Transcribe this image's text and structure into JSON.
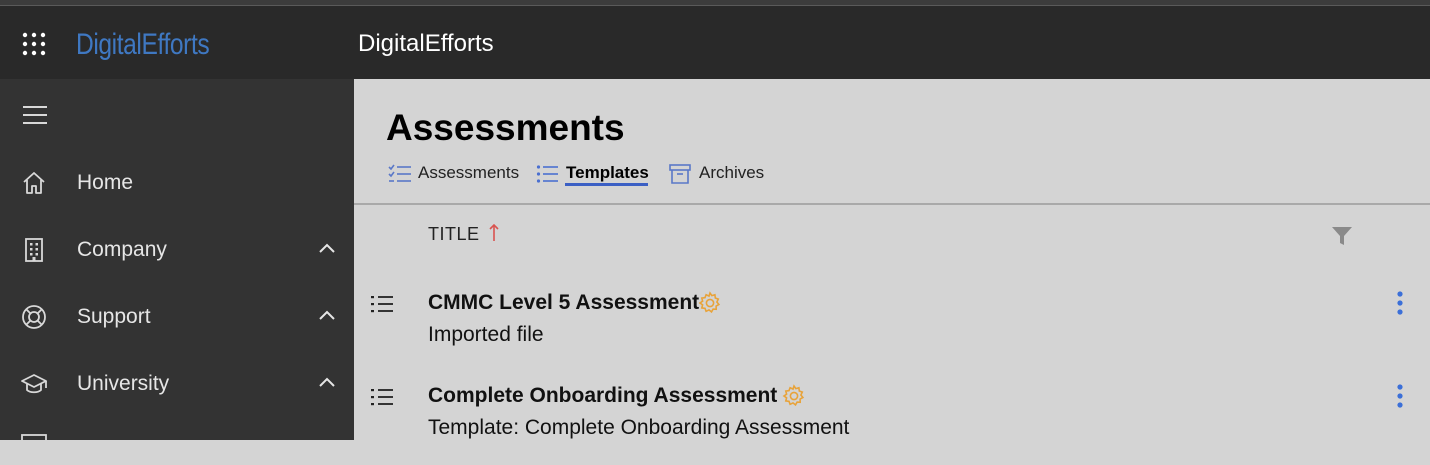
{
  "header": {
    "brand_logo": "DigitalEfforts",
    "app_title": "DigitalEfforts",
    "brand_color": "#3f78c2"
  },
  "sidebar": {
    "menu_icon": "hamburger-icon",
    "items": [
      {
        "label": "Home",
        "icon": "home-icon",
        "expandable": false
      },
      {
        "label": "Company",
        "icon": "building-icon",
        "expandable": true
      },
      {
        "label": "Support",
        "icon": "lifebuoy-icon",
        "expandable": true
      },
      {
        "label": "University",
        "icon": "graduation-cap-icon",
        "expandable": true
      }
    ]
  },
  "main": {
    "page_title": "Assessments",
    "tabs": [
      {
        "label": "Assessments",
        "icon": "checklist-icon",
        "active": false
      },
      {
        "label": "Templates",
        "icon": "list-icon",
        "active": true
      },
      {
        "label": "Archives",
        "icon": "archive-icon",
        "active": false
      }
    ],
    "table": {
      "column_header": "TITLE",
      "sort": "ascending",
      "rows": [
        {
          "title": "CMMC Level 5 Assessment",
          "subtitle": "Imported file"
        },
        {
          "title": "Complete Onboarding Assessment",
          "subtitle": "Template: Complete Onboarding Assessment"
        }
      ]
    }
  },
  "colors": {
    "accent": "#3b5fc4",
    "gear": "#e8a33a",
    "sort_arrow": "#d9534f",
    "kebab": "#3b6fd8"
  }
}
